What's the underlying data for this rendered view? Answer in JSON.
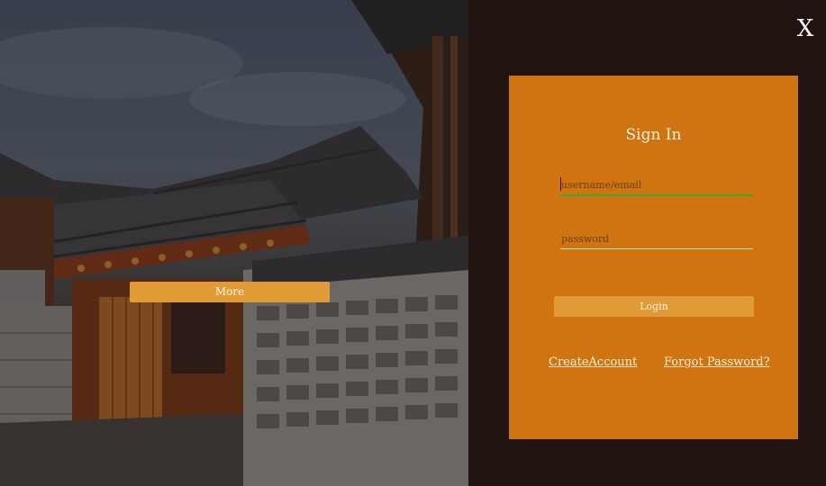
{
  "window": {
    "close_label": "X"
  },
  "hero": {
    "more_label": "More"
  },
  "signin": {
    "title": "Sign In",
    "username_placeholder": "username/email",
    "username_value": "",
    "password_placeholder": "password",
    "password_value": "",
    "login_label": "Login",
    "create_account_label": "CreateAccount",
    "forgot_password_label": "Forgot Password?"
  },
  "colors": {
    "background": "#211310",
    "card": "#cf7410",
    "button": "#e09b37",
    "focus_underline": "#3fa92e"
  }
}
